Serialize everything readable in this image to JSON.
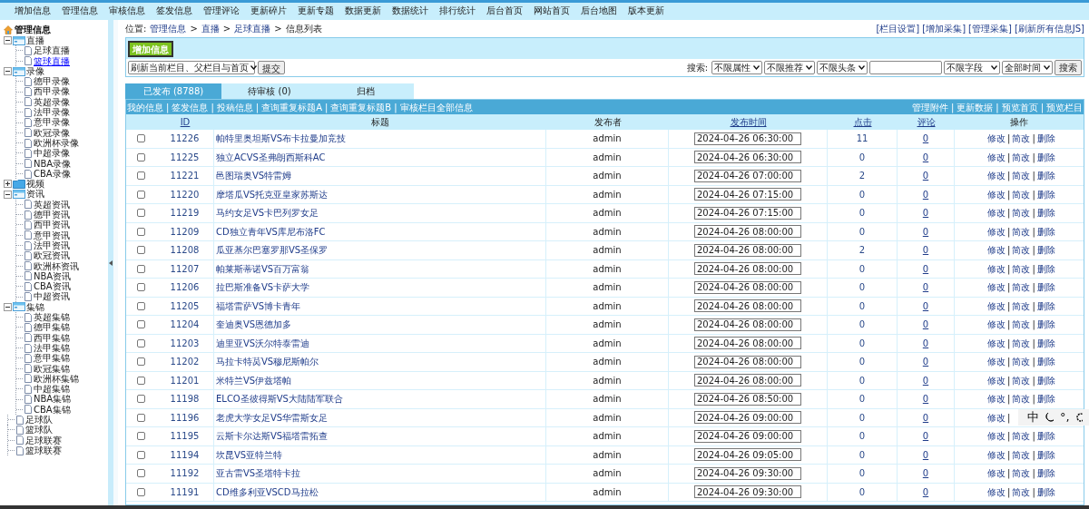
{
  "menu": [
    "增加信息",
    "管理信息",
    "审核信息",
    "签发信息",
    "管理评论",
    "更新碎片",
    "更新专题",
    "数据更新",
    "数据统计",
    "排行统计",
    "后台首页",
    "网站首页",
    "后台地图",
    "版本更新"
  ],
  "sidebar": {
    "title": "管理信息",
    "items": [
      {
        "label": "直播",
        "kind": "folder",
        "expanded": true,
        "selected": false,
        "children": [
          {
            "label": "足球直播",
            "kind": "page",
            "selected": false
          },
          {
            "label": "篮球直播",
            "kind": "page",
            "selected": true
          }
        ]
      },
      {
        "label": "录像",
        "kind": "folder",
        "expanded": true,
        "selected": false,
        "children": [
          {
            "label": "德甲录像",
            "kind": "page",
            "selected": false
          },
          {
            "label": "西甲录像",
            "kind": "page",
            "selected": false
          },
          {
            "label": "英超录像",
            "kind": "page",
            "selected": false
          },
          {
            "label": "法甲录像",
            "kind": "page",
            "selected": false
          },
          {
            "label": "意甲录像",
            "kind": "page",
            "selected": false
          },
          {
            "label": "欧冠录像",
            "kind": "page",
            "selected": false
          },
          {
            "label": "欧洲杯录像",
            "kind": "page",
            "selected": false
          },
          {
            "label": "中超录像",
            "kind": "page",
            "selected": false
          },
          {
            "label": "NBA录像",
            "kind": "page",
            "selected": false
          },
          {
            "label": "CBA录像",
            "kind": "page",
            "selected": false
          }
        ]
      },
      {
        "label": "视频",
        "kind": "folder",
        "expanded": false,
        "selected": false
      },
      {
        "label": "资讯",
        "kind": "folder",
        "expanded": true,
        "selected": false,
        "children": [
          {
            "label": "英超资讯",
            "kind": "page",
            "selected": false
          },
          {
            "label": "德甲资讯",
            "kind": "page",
            "selected": false
          },
          {
            "label": "西甲资讯",
            "kind": "page",
            "selected": false
          },
          {
            "label": "意甲资讯",
            "kind": "page",
            "selected": false
          },
          {
            "label": "法甲资讯",
            "kind": "page",
            "selected": false
          },
          {
            "label": "欧冠资讯",
            "kind": "page",
            "selected": false
          },
          {
            "label": "欧洲杯资讯",
            "kind": "page",
            "selected": false
          },
          {
            "label": "NBA资讯",
            "kind": "page",
            "selected": false
          },
          {
            "label": "CBA资讯",
            "kind": "page",
            "selected": false
          },
          {
            "label": "中超资讯",
            "kind": "page",
            "selected": false
          }
        ]
      },
      {
        "label": "集锦",
        "kind": "folder",
        "expanded": true,
        "selected": false,
        "children": [
          {
            "label": "英超集锦",
            "kind": "page",
            "selected": false
          },
          {
            "label": "德甲集锦",
            "kind": "page",
            "selected": false
          },
          {
            "label": "西甲集锦",
            "kind": "page",
            "selected": false
          },
          {
            "label": "法甲集锦",
            "kind": "page",
            "selected": false
          },
          {
            "label": "意甲集锦",
            "kind": "page",
            "selected": false
          },
          {
            "label": "欧冠集锦",
            "kind": "page",
            "selected": false
          },
          {
            "label": "欧洲杯集锦",
            "kind": "page",
            "selected": false
          },
          {
            "label": "中超集锦",
            "kind": "page",
            "selected": false
          },
          {
            "label": "NBA集锦",
            "kind": "page",
            "selected": false
          },
          {
            "label": "CBA集锦",
            "kind": "page",
            "selected": false
          }
        ]
      },
      {
        "label": "足球队",
        "kind": "page",
        "selected": false
      },
      {
        "label": "篮球队",
        "kind": "page",
        "selected": false
      },
      {
        "label": "足球联赛",
        "kind": "page",
        "selected": false
      },
      {
        "label": "篮球联赛",
        "kind": "page",
        "selected": false
      }
    ]
  },
  "breadcrumb": {
    "label": "位置:",
    "links": [
      "管理信息",
      "直播",
      "足球直播"
    ],
    "sep": ">",
    "current": "信息列表"
  },
  "top_links": [
    "[栏目设置]",
    "[增加采集]",
    "[管理采集]",
    "[刷新所有信息JS]"
  ],
  "add_button": "增加信息",
  "refresh_select": "刷新当前栏目、父栏目与首页",
  "submit": "提交",
  "search": {
    "label": "搜索:",
    "filters": [
      "不限属性",
      "不限推荐",
      "不限头条"
    ],
    "field": "不限字段",
    "time": "全部时间",
    "button": "搜索"
  },
  "tabs": [
    {
      "label": "已发布 (8788)",
      "selected": true
    },
    {
      "label": "待审核 (0)",
      "selected": false
    },
    {
      "label": "归档",
      "selected": false
    }
  ],
  "separator": "|",
  "link_bar": {
    "left": [
      "我的信息",
      "签发信息",
      "投稿信息",
      "查询重复标题A",
      "查询重复标题B",
      "审核栏目全部信息"
    ],
    "right": [
      "管理附件",
      "更新数据",
      "预览首页",
      "预览栏目"
    ]
  },
  "columns": [
    {
      "label": "ID",
      "sortable": true
    },
    {
      "label": "标题",
      "sortable": false
    },
    {
      "label": "发布者",
      "sortable": false
    },
    {
      "label": "发布时间",
      "sortable": true
    },
    {
      "label": "点击",
      "sortable": true
    },
    {
      "label": "评论",
      "sortable": true
    },
    {
      "label": "操作",
      "sortable": false
    }
  ],
  "rows": [
    {
      "id": "11226",
      "title": "帕特里奥坦斯VS布卡拉曼加竞技",
      "publisher": "admin",
      "time": "2024-04-26 06:30:00",
      "clicks": "11",
      "comments": "0",
      "checked": false,
      "actions": [
        "修改",
        "简改",
        "删除"
      ]
    },
    {
      "id": "11225",
      "title": "独立ACVS圣弗朗西斯科AC",
      "publisher": "admin",
      "time": "2024-04-26 06:30:00",
      "clicks": "0",
      "comments": "0",
      "checked": false,
      "actions": [
        "修改",
        "简改",
        "删除"
      ]
    },
    {
      "id": "11221",
      "title": "邑图瑞奥VS特雷姆",
      "publisher": "admin",
      "time": "2024-04-26 07:00:00",
      "clicks": "2",
      "comments": "0",
      "checked": false,
      "actions": [
        "修改",
        "简改",
        "删除"
      ]
    },
    {
      "id": "11220",
      "title": "摩塔瓜VS托克亚皇家苏斯达",
      "publisher": "admin",
      "time": "2024-04-26 07:15:00",
      "clicks": "0",
      "comments": "0",
      "checked": false,
      "actions": [
        "修改",
        "简改",
        "删除"
      ]
    },
    {
      "id": "11219",
      "title": "马约女足VS卡巴列罗女足",
      "publisher": "admin",
      "time": "2024-04-26 07:15:00",
      "clicks": "0",
      "comments": "0",
      "checked": false,
      "actions": [
        "修改",
        "简改",
        "删除"
      ]
    },
    {
      "id": "11209",
      "title": "CD独立青年VS库尼布洛FC",
      "publisher": "admin",
      "time": "2024-04-26 08:00:00",
      "clicks": "0",
      "comments": "0",
      "checked": false,
      "actions": [
        "修改",
        "简改",
        "删除"
      ]
    },
    {
      "id": "11208",
      "title": "瓜亚基尔巴塞罗那VS圣保罗",
      "publisher": "admin",
      "time": "2024-04-26 08:00:00",
      "clicks": "2",
      "comments": "0",
      "checked": false,
      "actions": [
        "修改",
        "简改",
        "删除"
      ]
    },
    {
      "id": "11207",
      "title": "帕莱斯蒂诺VS百万富翁",
      "publisher": "admin",
      "time": "2024-04-26 08:00:00",
      "clicks": "0",
      "comments": "0",
      "checked": false,
      "actions": [
        "修改",
        "简改",
        "删除"
      ]
    },
    {
      "id": "11206",
      "title": "拉巴斯准备VS卡萨大学",
      "publisher": "admin",
      "time": "2024-04-26 08:00:00",
      "clicks": "0",
      "comments": "0",
      "checked": false,
      "actions": [
        "修改",
        "简改",
        "删除"
      ]
    },
    {
      "id": "11205",
      "title": "福塔雷萨VS博卡青年",
      "publisher": "admin",
      "time": "2024-04-26 08:00:00",
      "clicks": "0",
      "comments": "0",
      "checked": false,
      "actions": [
        "修改",
        "简改",
        "删除"
      ]
    },
    {
      "id": "11204",
      "title": "奎迪奥VS恩德加多",
      "publisher": "admin",
      "time": "2024-04-26 08:00:00",
      "clicks": "0",
      "comments": "0",
      "checked": false,
      "actions": [
        "修改",
        "简改",
        "删除"
      ]
    },
    {
      "id": "11203",
      "title": "迪里亚VS沃尔特泰雷迪",
      "publisher": "admin",
      "time": "2024-04-26 08:00:00",
      "clicks": "0",
      "comments": "0",
      "checked": false,
      "actions": [
        "修改",
        "简改",
        "删除"
      ]
    },
    {
      "id": "11202",
      "title": "马拉卡特莴VS穆尼斯帕尔",
      "publisher": "admin",
      "time": "2024-04-26 08:00:00",
      "clicks": "0",
      "comments": "0",
      "checked": false,
      "actions": [
        "修改",
        "简改",
        "删除"
      ]
    },
    {
      "id": "11201",
      "title": "米特兰VS伊兹塔帕",
      "publisher": "admin",
      "time": "2024-04-26 08:00:00",
      "clicks": "0",
      "comments": "0",
      "checked": false,
      "actions": [
        "修改",
        "简改",
        "删除"
      ]
    },
    {
      "id": "11198",
      "title": "ELCO圣彼得斯VS大陆陆军联合",
      "publisher": "admin",
      "time": "2024-04-26 08:50:00",
      "clicks": "0",
      "comments": "0",
      "checked": false,
      "actions": [
        "修改",
        "简改",
        "删除"
      ]
    },
    {
      "id": "11196",
      "title": "老虎大学女足VS华雷斯女足",
      "publisher": "admin",
      "time": "2024-04-26 09:00:00",
      "clicks": "0",
      "comments": "0",
      "checked": false,
      "actions": [
        "修改"
      ]
    },
    {
      "id": "11195",
      "title": "云斯卡尔达斯VS福塔雷拓查",
      "publisher": "admin",
      "time": "2024-04-26 09:00:00",
      "clicks": "0",
      "comments": "0",
      "checked": false,
      "actions": [
        "修改",
        "简改",
        "删除"
      ]
    },
    {
      "id": "11194",
      "title": "坎昆VS亚特兰特",
      "publisher": "admin",
      "time": "2024-04-26 09:05:00",
      "clicks": "0",
      "comments": "0",
      "checked": false,
      "actions": [
        "修改",
        "简改",
        "删除"
      ]
    },
    {
      "id": "11192",
      "title": "亚古雷VS圣塔特卡拉",
      "publisher": "admin",
      "time": "2024-04-26 09:30:00",
      "clicks": "0",
      "comments": "0",
      "checked": false,
      "actions": [
        "修改",
        "简改",
        "删除"
      ]
    },
    {
      "id": "11191",
      "title": "CD维多利亚VSCD马拉松",
      "publisher": "admin",
      "time": "2024-04-26 09:30:00",
      "clicks": "0",
      "comments": "0",
      "checked": false,
      "actions": [
        "修改",
        "简改",
        "删除"
      ]
    }
  ],
  "ime_toolbar": {
    "mode": "中",
    "punctuation": "°,"
  }
}
